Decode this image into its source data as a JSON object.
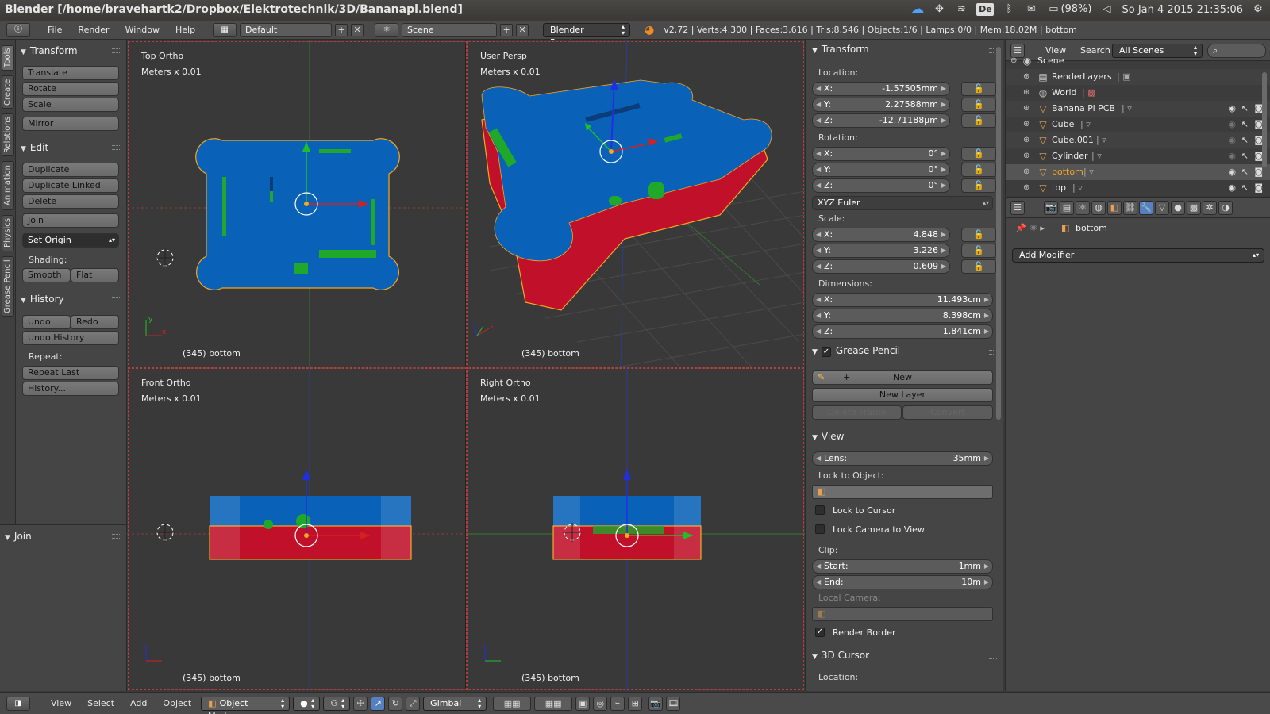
{
  "os": {
    "window_title": "Blender [/home/bravehartk2/Dropbox/Elektrotechnik/3D/Bananapi.blend]",
    "keyboard": "De",
    "battery": "(98%)",
    "clock": "So Jan 4 2015 21:35:06"
  },
  "info": {
    "menus": [
      "File",
      "Render",
      "Window",
      "Help"
    ],
    "layout": "Default",
    "scene": "Scene",
    "engine": "Blender Render",
    "stats": "v2.72 | Verts:4,300 | Faces:3,616 | Tris:8,546 | Objects:1/6 | Lamps:0/0 | Mem:18.02M | bottom"
  },
  "tabs": [
    "Tools",
    "Create",
    "Relations",
    "Animation",
    "Physics",
    "Grease Pencil"
  ],
  "toolshelf": {
    "transform_title": "Transform",
    "translate": "Translate",
    "rotate": "Rotate",
    "scale": "Scale",
    "mirror": "Mirror",
    "edit_title": "Edit",
    "duplicate": "Duplicate",
    "duplicate_linked": "Duplicate Linked",
    "delete": "Delete",
    "join": "Join",
    "set_origin": "Set Origin",
    "shading_label": "Shading:",
    "smooth": "Smooth",
    "flat": "Flat",
    "history_title": "History",
    "undo": "Undo",
    "redo": "Redo",
    "undo_history": "Undo History",
    "repeat_label": "Repeat:",
    "repeat_last": "Repeat Last",
    "history_btn": "History...",
    "join_panel": "Join"
  },
  "viewports": {
    "top": {
      "name": "Top Ortho",
      "units": "Meters x 0.01",
      "footer": "(345) bottom"
    },
    "persp": {
      "name": "User Persp",
      "units": "Meters x 0.01",
      "footer": "(345) bottom"
    },
    "front": {
      "name": "Front Ortho",
      "units": "Meters x 0.01",
      "footer": "(345) bottom"
    },
    "right": {
      "name": "Right Ortho",
      "units": "Meters x 0.01",
      "footer": "(345) bottom"
    }
  },
  "npanel": {
    "transform_title": "Transform",
    "location_label": "Location:",
    "location": [
      {
        "k": "X:",
        "v": "-1.57505mm"
      },
      {
        "k": "Y:",
        "v": "2.27588mm"
      },
      {
        "k": "Z:",
        "v": "-12.71188µm"
      }
    ],
    "rotation_label": "Rotation:",
    "rotation": [
      {
        "k": "X:",
        "v": "0°"
      },
      {
        "k": "Y:",
        "v": "0°"
      },
      {
        "k": "Z:",
        "v": "0°"
      }
    ],
    "rotation_mode": "XYZ Euler",
    "scale_label": "Scale:",
    "scale": [
      {
        "k": "X:",
        "v": "4.848"
      },
      {
        "k": "Y:",
        "v": "3.226"
      },
      {
        "k": "Z:",
        "v": "0.609"
      }
    ],
    "dimensions_label": "Dimensions:",
    "dimensions": [
      {
        "k": "X:",
        "v": "11.493cm"
      },
      {
        "k": "Y:",
        "v": "8.398cm"
      },
      {
        "k": "Z:",
        "v": "1.841cm"
      }
    ],
    "grease_title": "Grease Pencil",
    "new": "New",
    "new_layer": "New Layer",
    "delete_frame": "Delete Frame",
    "convert": "Convert",
    "view_title": "View",
    "lens_label": "Lens:",
    "lens_value": "35mm",
    "lock_object_label": "Lock to Object:",
    "lock_cursor": "Lock to Cursor",
    "lock_camera": "Lock Camera to View",
    "clip_label": "Clip:",
    "clip_start_label": "Start:",
    "clip_start": "1mm",
    "clip_end_label": "End:",
    "clip_end": "10m",
    "local_camera": "Local Camera:",
    "render_border": "Render Border",
    "cursor_title": "3D Cursor",
    "cursor_location": "Location:"
  },
  "outliner": {
    "view": "View",
    "search": "Search",
    "filter": "All Scenes",
    "rows": [
      {
        "name": "Scene",
        "icon": "scene-icon"
      },
      {
        "name": "RenderLayers",
        "icon": "renderlayers-icon"
      },
      {
        "name": "World",
        "icon": "world-icon"
      },
      {
        "name": "Banana Pi PCB",
        "icon": "mesh-icon"
      },
      {
        "name": "Cube",
        "icon": "mesh-icon"
      },
      {
        "name": "Cube.001",
        "icon": "mesh-icon"
      },
      {
        "name": "Cylinder",
        "icon": "mesh-icon"
      },
      {
        "name": "bottom",
        "icon": "mesh-icon"
      },
      {
        "name": "top",
        "icon": "mesh-icon"
      }
    ]
  },
  "props": {
    "object_name": "bottom",
    "add_modifier": "Add Modifier"
  },
  "bottom_header": {
    "view": "View",
    "select": "Select",
    "add": "Add",
    "object": "Object",
    "mode": "Object Mode",
    "orientation": "Gimbal"
  },
  "colors": {
    "blue_part": "#0a62b8",
    "red_part": "#c0102a",
    "green_part": "#1fa82a",
    "selection": "#f5a623",
    "accent": "#5680c2"
  }
}
